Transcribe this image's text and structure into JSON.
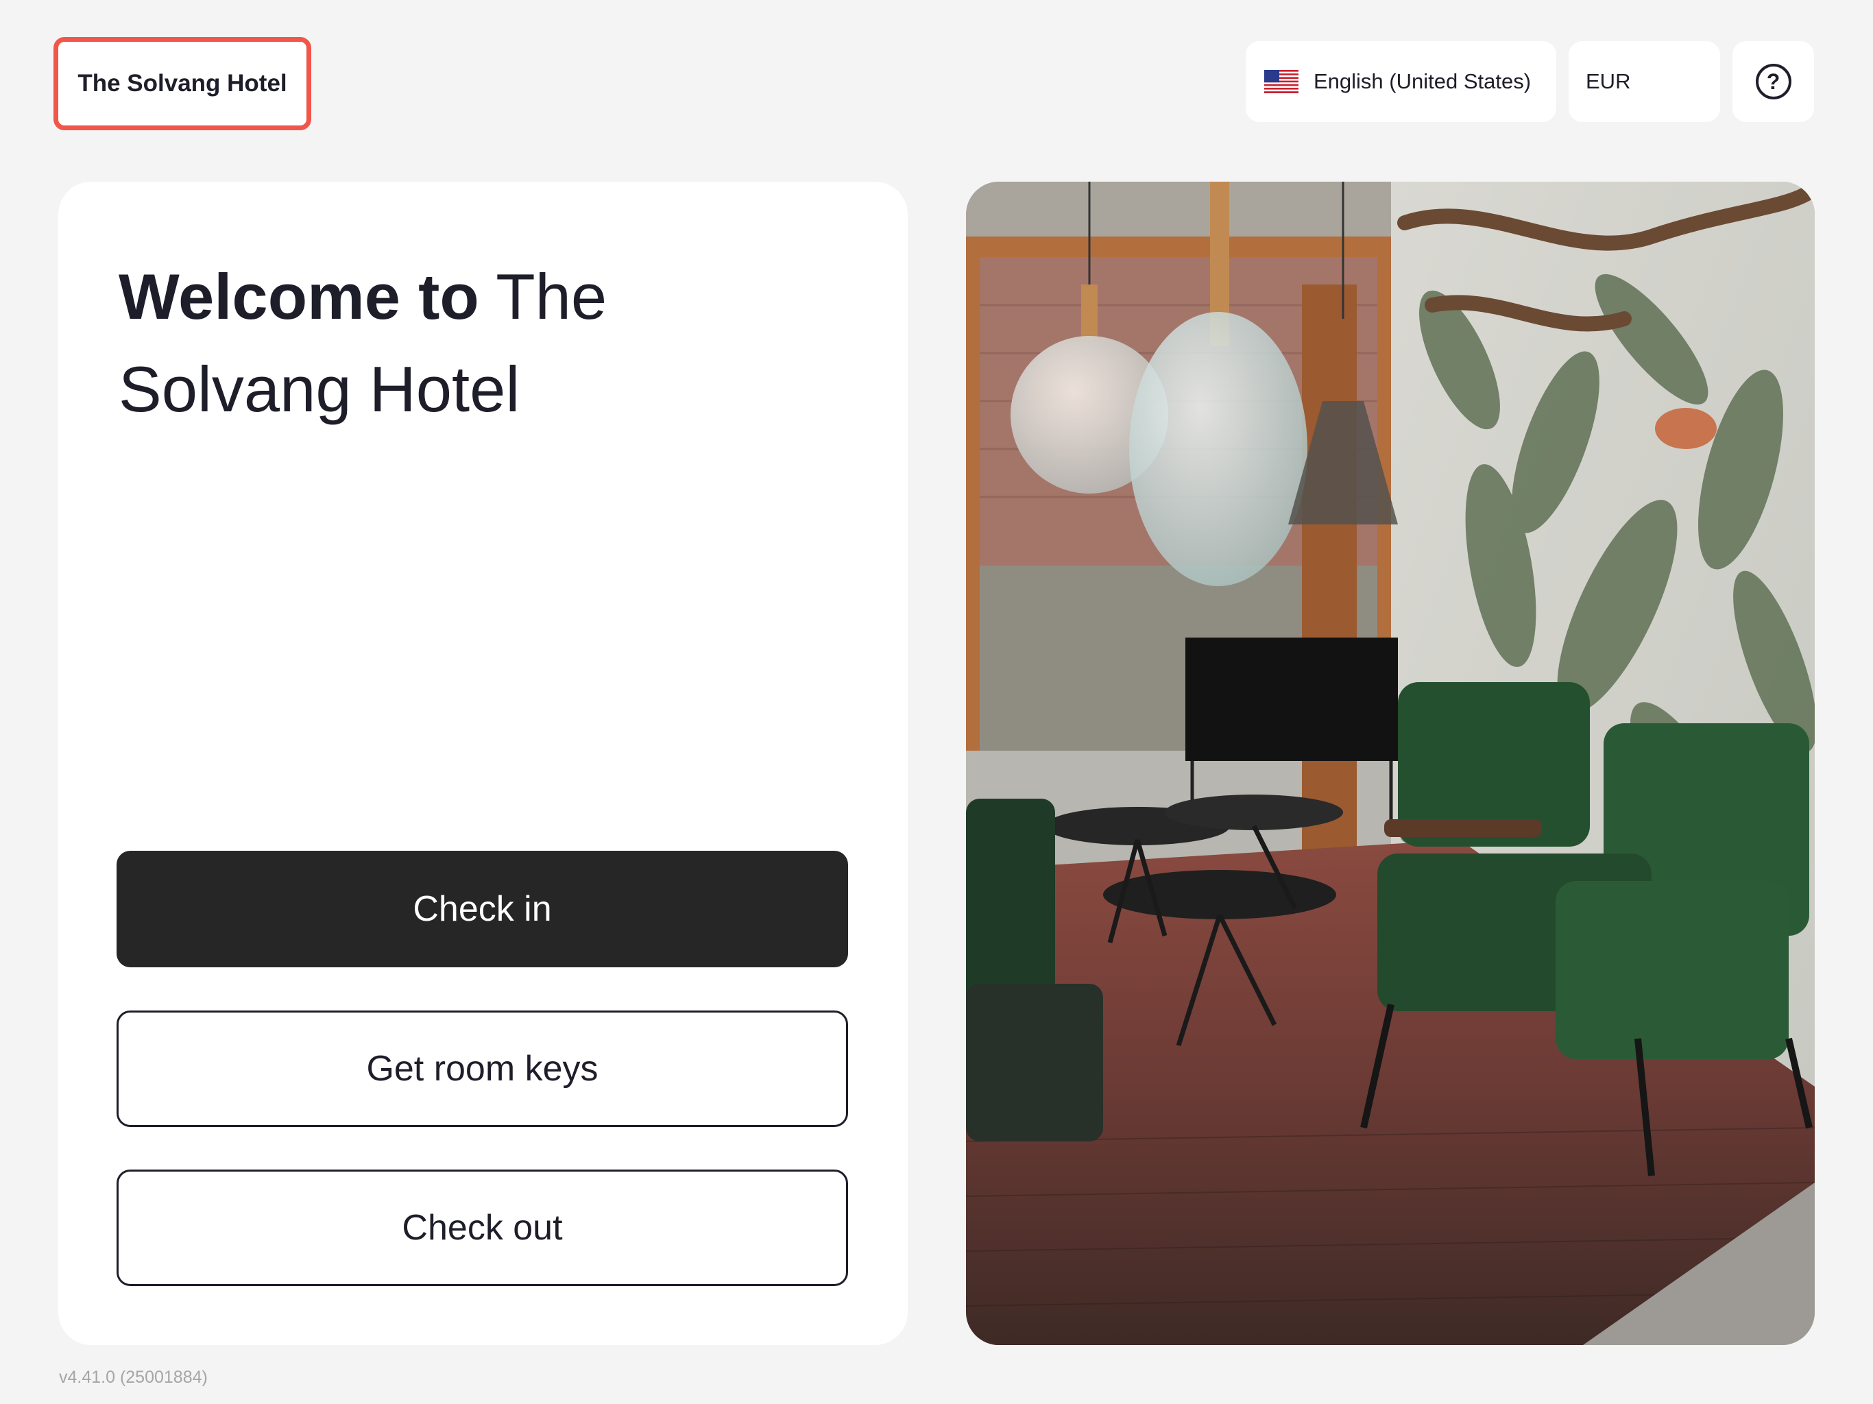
{
  "header": {
    "hotel_name": "The Solvang Hotel",
    "language": {
      "flag_icon": "us-flag-icon",
      "label": "English (United States)"
    },
    "currency": "EUR",
    "help_icon": "help-icon",
    "help_glyph": "?"
  },
  "welcome": {
    "strong": "Welcome to",
    "name": "The Solvang Hotel"
  },
  "actions": {
    "check_in": "Check in",
    "get_room_keys": "Get room keys",
    "check_out": "Check out"
  },
  "version": "v4.41.0 (25001884)",
  "colors": {
    "background": "#f4f4f4",
    "badge_border": "#f0564a",
    "primary_button": "#262626",
    "text": "#1e1e2a"
  }
}
